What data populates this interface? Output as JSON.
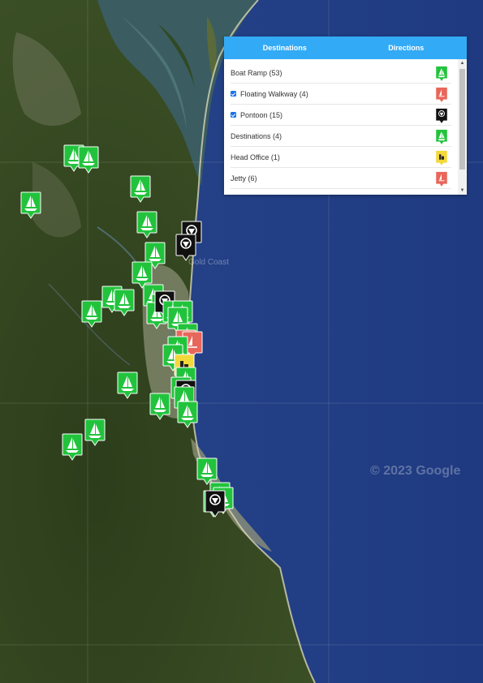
{
  "map": {
    "watermark": "© 2023 Google",
    "faint_label": "Gold Coast",
    "colors": {
      "land": "#33471f",
      "ocean": "#233f86",
      "city": "#8f9478",
      "river": "#5f7c8e"
    },
    "markers": [
      {
        "type": "boat-ramp",
        "color": "#22c33c"
      },
      {
        "type": "boat-ramp",
        "color": "#22c33c"
      },
      {
        "type": "boat-ramp",
        "color": "#22c33c"
      },
      {
        "type": "boat-ramp",
        "color": "#22c33c"
      },
      {
        "type": "boat-ramp",
        "color": "#22c33c"
      },
      {
        "type": "pontoon",
        "color": "#111111"
      },
      {
        "type": "pontoon",
        "color": "#111111"
      },
      {
        "type": "boat-ramp",
        "color": "#22c33c"
      },
      {
        "type": "boat-ramp",
        "color": "#22c33c"
      },
      {
        "type": "boat-ramp",
        "color": "#22c33c"
      },
      {
        "type": "boat-ramp",
        "color": "#22c33c"
      },
      {
        "type": "boat-ramp",
        "color": "#22c33c"
      },
      {
        "type": "boat-ramp",
        "color": "#22c33c"
      },
      {
        "type": "boat-ramp",
        "color": "#22c33c"
      },
      {
        "type": "pontoon",
        "color": "#111111"
      },
      {
        "type": "boat-ramp",
        "color": "#22c33c"
      },
      {
        "type": "boat-ramp",
        "color": "#22c33c"
      },
      {
        "type": "boat-ramp",
        "color": "#22c33c"
      },
      {
        "type": "boat-ramp",
        "color": "#22c33c"
      },
      {
        "type": "boat-ramp",
        "color": "#22c33c"
      },
      {
        "type": "jetty",
        "color": "#e8665a"
      },
      {
        "type": "jetty",
        "color": "#e8665a"
      },
      {
        "type": "boat-ramp",
        "color": "#22c33c"
      },
      {
        "type": "boat-ramp",
        "color": "#22c33c"
      },
      {
        "type": "head-office",
        "color": "#f2d83a"
      },
      {
        "type": "boat-ramp",
        "color": "#22c33c"
      },
      {
        "type": "boat-ramp",
        "color": "#22c33c"
      },
      {
        "type": "boat-ramp",
        "color": "#22c33c"
      },
      {
        "type": "pontoon",
        "color": "#111111"
      },
      {
        "type": "boat-ramp",
        "color": "#22c33c"
      },
      {
        "type": "boat-ramp",
        "color": "#22c33c"
      },
      {
        "type": "boat-ramp",
        "color": "#22c33c"
      },
      {
        "type": "boat-ramp",
        "color": "#22c33c"
      },
      {
        "type": "boat-ramp",
        "color": "#22c33c"
      },
      {
        "type": "boat-ramp",
        "color": "#22c33c"
      },
      {
        "type": "boat-ramp",
        "color": "#22c33c"
      },
      {
        "type": "boat-ramp",
        "color": "#22c33c"
      },
      {
        "type": "boat-ramp",
        "color": "#22c33c"
      },
      {
        "type": "pontoon",
        "color": "#111111"
      }
    ]
  },
  "panel": {
    "tabs": [
      "Destinations",
      "Directions"
    ],
    "layers": [
      {
        "label": "Boat Ramp (53)",
        "checked": false,
        "icon": "boat-ramp-icon",
        "color": "#22c33c"
      },
      {
        "label": "Floating Walkway (4)",
        "checked": true,
        "icon": "floating-walkway-icon",
        "color": "#e8665a"
      },
      {
        "label": "Pontoon (15)",
        "checked": true,
        "icon": "pontoon-icon",
        "color": "#111111"
      },
      {
        "label": "Destinations (4)",
        "checked": false,
        "icon": "destination-boat-icon",
        "color": "#22c33c"
      },
      {
        "label": "Head Office (1)",
        "checked": false,
        "icon": "head-office-icon",
        "color": "#f2d83a"
      },
      {
        "label": "Jetty (6)",
        "checked": false,
        "icon": "jetty-icon",
        "color": "#e8665a"
      }
    ]
  }
}
